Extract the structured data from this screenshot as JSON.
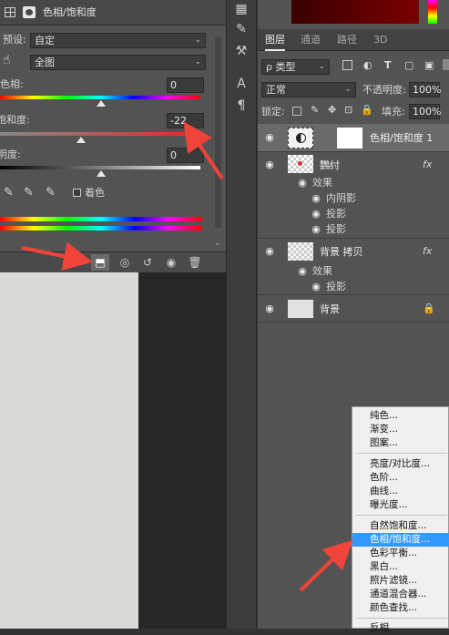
{
  "properties": {
    "title": "色相/饱和度",
    "preset_label": "预设:",
    "preset_value": "自定",
    "channel_value": "全图",
    "hue_label": "色相:",
    "hue_value": "0",
    "saturation_label": "饱和度:",
    "saturation_value": "-22",
    "lightness_label": "明度:",
    "lightness_value": "0",
    "colorize_label": "着色"
  },
  "tabs": [
    "图层",
    "通道",
    "路径",
    "3D"
  ],
  "filter": {
    "kind": "ρ 类型"
  },
  "blend": {
    "mode": "正常",
    "opacity_label": "不透明度:",
    "opacity_value": "100%"
  },
  "lock": {
    "label": "锁定:",
    "fill_label": "填充:",
    "fill_value": "100%"
  },
  "layers": {
    "adjustment": "色相/饱和度 1",
    "text_layer": "鸚纣",
    "effects_label": "效果",
    "inner_shadow": "内阴影",
    "drop_shadow_1": "投影",
    "drop_shadow_2": "投影",
    "copy_layer": "背景 拷贝",
    "effects_label_2": "效果",
    "drop_shadow_3": "投影",
    "background": "背景",
    "fx": "fx"
  },
  "menu": {
    "items": [
      "纯色...",
      "渐变...",
      "图案...",
      "亮度/对比度...",
      "色阶...",
      "曲线...",
      "曝光度...",
      "自然饱和度...",
      "色相/饱和度...",
      "色彩平衡...",
      "黑白...",
      "照片滤镜...",
      "通道混合器...",
      "颜色查找...",
      "反相"
    ],
    "highlighted_index": 8
  },
  "colors": {
    "accent": "#3399ff",
    "arrow": "#f0433a"
  }
}
